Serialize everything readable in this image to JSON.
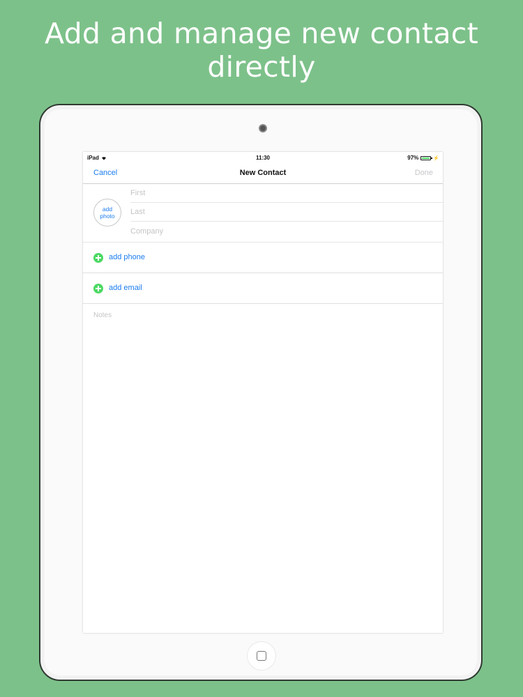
{
  "headline": "Add and manage new contact directly",
  "status_bar": {
    "device": "iPad",
    "time": "11:30",
    "battery": "97%",
    "battery_level": 0.97
  },
  "nav": {
    "cancel": "Cancel",
    "title": "New Contact",
    "done": "Done"
  },
  "photo": {
    "line1": "add",
    "line2": "photo"
  },
  "fields": {
    "first_placeholder": "First",
    "last_placeholder": "Last",
    "company_placeholder": "Company"
  },
  "actions": {
    "add_phone": "add phone",
    "add_email": "add email"
  },
  "notes": {
    "placeholder": "Notes"
  },
  "colors": {
    "background": "#7dc18a",
    "accent": "#1a7cf0",
    "add_button": "#4cd964",
    "done_disabled": "#c7c7cc"
  },
  "icons": [
    "camera-icon",
    "wifi-icon",
    "battery-icon",
    "charging-icon",
    "plus-icon",
    "home-button-icon"
  ]
}
